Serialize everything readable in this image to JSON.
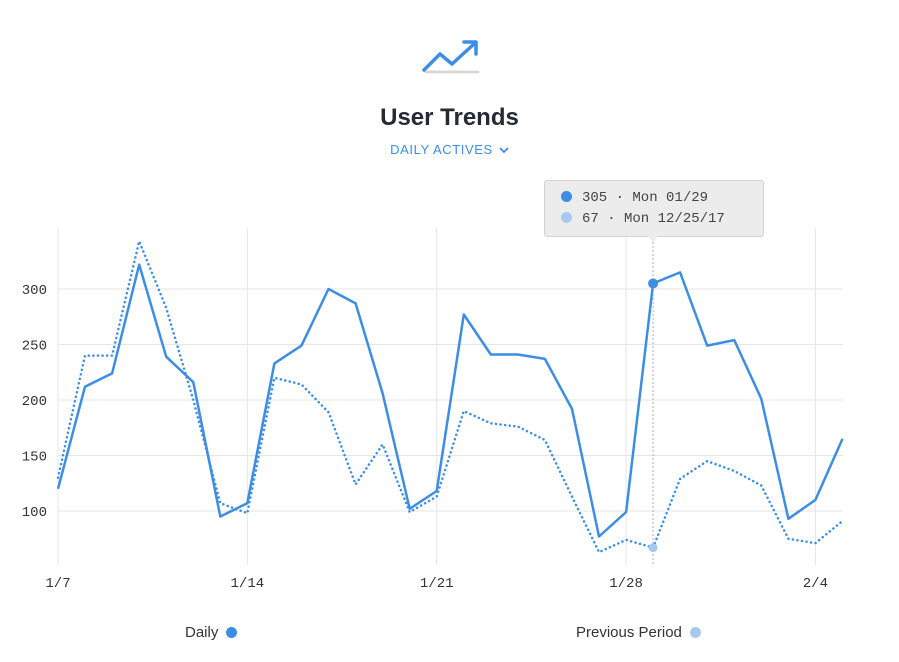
{
  "header": {
    "logo_icon": "trend-up-icon",
    "title": "User Trends",
    "metric_label": "DAILY ACTIVES",
    "metric_icon": "chevron-down-icon"
  },
  "colors": {
    "primary": "#3d8ee3",
    "previous": "#a7c9f1",
    "grid": "#e6e6e6",
    "title": "#222b36"
  },
  "tooltip": {
    "current": "305 · Mon 01/29",
    "previous": "67 · Mon 12/25/17"
  },
  "legend": {
    "daily": "Daily",
    "previous": "Previous Period"
  },
  "chart_data": {
    "type": "line",
    "x_day_start": 7,
    "x_tick_labels": [
      "1/7",
      "1/14",
      "1/21",
      "1/28",
      "2/4"
    ],
    "y_ticks": [
      100,
      150,
      200,
      250,
      300
    ],
    "ylim": [
      55,
      355
    ],
    "grid": true,
    "legend_position": "bottom",
    "highlight_index": 22,
    "series": [
      {
        "name": "Daily",
        "style": "solid",
        "values": [
          120,
          212,
          224,
          322,
          239,
          216,
          95,
          107,
          233,
          249,
          300,
          287,
          206,
          102,
          118,
          277,
          241,
          241,
          237,
          192,
          77,
          99,
          305,
          315,
          249,
          254,
          201,
          93,
          110,
          165
        ]
      },
      {
        "name": "Previous Period",
        "style": "dotted",
        "values": [
          130,
          240,
          240,
          343,
          283,
          200,
          107,
          98,
          220,
          214,
          189,
          124,
          160,
          99,
          113,
          190,
          179,
          176,
          164,
          113,
          63,
          74,
          67,
          129,
          145,
          136,
          123,
          75,
          71,
          91
        ]
      }
    ]
  }
}
